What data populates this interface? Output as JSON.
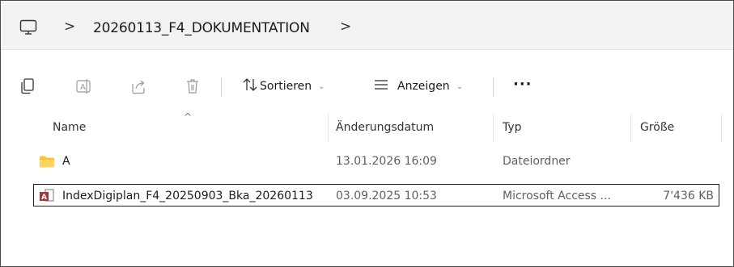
{
  "address": {
    "pc_icon": "computer-icon",
    "separator": ">",
    "path": "20260113_F4_DOKUMENTATION",
    "trailing_separator": ">"
  },
  "toolbar": {
    "icons": [
      "copy-icon",
      "rename-icon",
      "share-icon",
      "delete-icon"
    ],
    "sort_label": "Sortieren",
    "view_label": "Anzeigen",
    "more_label": "···"
  },
  "columns": {
    "name": "Name",
    "date": "Änderungsdatum",
    "type": "Typ",
    "size": "Größe",
    "sort_indicator": "^"
  },
  "rows": [
    {
      "icon": "folder-icon",
      "name": "A",
      "date": "13.01.2026 16:09",
      "type": "Dateiordner",
      "size": ""
    },
    {
      "icon": "access-file-icon",
      "name": "IndexDigiplan_F4_20250903_Bka_20260113",
      "date": "03.09.2025 10:53",
      "type": "Microsoft Access ...",
      "size": "7'436 KB",
      "selected": true
    }
  ],
  "colors": {
    "folder": "#f4c430",
    "access": "#a4373a",
    "chrome_bg": "#f3f3f3"
  }
}
